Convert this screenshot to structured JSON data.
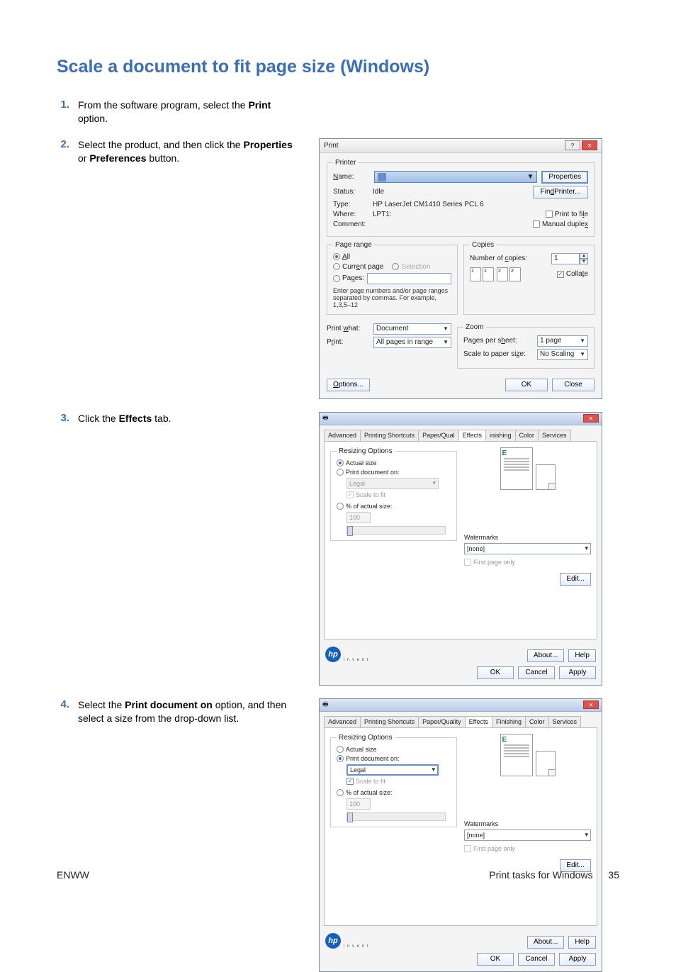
{
  "title": "Scale a document to fit page size (Windows)",
  "steps": {
    "s1": {
      "num": "1.",
      "text_a": "From the software program, select the ",
      "b1": "Print",
      "text_b": " option."
    },
    "s2": {
      "num": "2.",
      "text_a": "Select the product, and then click the ",
      "b1": "Properties",
      "text_b": " or ",
      "b2": "Preferences",
      "text_c": " button."
    },
    "s3": {
      "num": "3.",
      "text_a": "Click the ",
      "b1": "Effects",
      "text_b": " tab."
    },
    "s4": {
      "num": "4.",
      "text_a": "Select the ",
      "b1": "Print document on",
      "text_b": " option, and then select a size from the drop-down list."
    }
  },
  "print_dialog": {
    "title": "Print",
    "printer_legend": "Printer",
    "name_label": "Name:",
    "status_label": "Status:",
    "status_value": "Idle",
    "type_label": "Type:",
    "type_value": "HP LaserJet CM1410 Series PCL 6",
    "where_label": "Where:",
    "where_value": "LPT1:",
    "comment_label": "Comment:",
    "properties_btn": "Properties",
    "find_printer_btn": "Find Printer...",
    "print_to_file": "Print to file",
    "manual_duplex": "Manual duplex",
    "page_range_legend": "Page range",
    "all": "All",
    "current_page": "Current page",
    "selection": "Selection",
    "pages": "Pages:",
    "pages_hint": "Enter page numbers and/or page ranges separated by commas. For example, 1,3,5–12",
    "copies_legend": "Copies",
    "num_copies_label": "Number of copies:",
    "num_copies_value": "1",
    "collate": "Collate",
    "print_what_label": "Print what:",
    "print_what_value": "Document",
    "print_label": "Print:",
    "print_value": "All pages in range",
    "zoom_legend": "Zoom",
    "pps_label": "Pages per sheet:",
    "pps_value": "1 page",
    "stps_label": "Scale to paper size:",
    "stps_value": "No Scaling",
    "options_btn": "Options...",
    "ok_btn": "OK",
    "close_btn": "Close"
  },
  "effects_dialog": {
    "tabs": [
      "Advanced",
      "Printing Shortcuts",
      "Paper/Quality",
      "Effects",
      "Finishing",
      "Color",
      "Services"
    ],
    "resizing_legend": "Resizing Options",
    "actual_size": "Actual size",
    "print_doc_on": "Print document on:",
    "paper_value": "Legal",
    "scale_to_fit": "Scale to fit",
    "pct_actual": "% of actual size:",
    "pct_value": "100",
    "watermarks_label": "Watermarks",
    "watermarks_value": "[none]",
    "first_page_only": "First page only",
    "edit_btn": "Edit...",
    "about_btn": "About...",
    "help_btn": "Help",
    "ok_btn": "OK",
    "cancel_btn": "Cancel",
    "apply_btn": "Apply",
    "invent": "i n v e n t"
  },
  "footer": {
    "left": "ENWW",
    "right": "Print tasks for Windows",
    "page": "35"
  }
}
